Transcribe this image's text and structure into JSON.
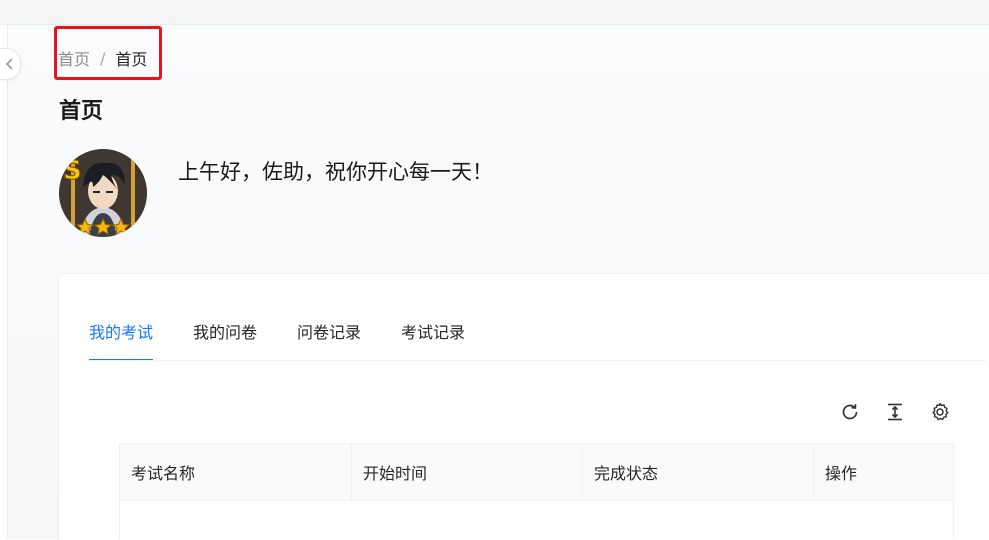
{
  "breadcrumb": {
    "root": "首页",
    "separator": "/",
    "current": "首页"
  },
  "page": {
    "title": "首页"
  },
  "greeting": {
    "text": "上午好，佐助，祝你开心每一天！"
  },
  "tabs": [
    {
      "label": "我的考试",
      "active": true
    },
    {
      "label": "我的问卷",
      "active": false
    },
    {
      "label": "问卷记录",
      "active": false
    },
    {
      "label": "考试记录",
      "active": false
    }
  ],
  "toolbar": {
    "icons": [
      "refresh-icon",
      "density-icon",
      "settings-icon"
    ]
  },
  "table": {
    "columns": [
      "考试名称",
      "开始时间",
      "完成状态",
      "操作"
    ],
    "rows": []
  },
  "colors": {
    "accent": "#1677ff",
    "highlight_border": "#e8141c"
  }
}
